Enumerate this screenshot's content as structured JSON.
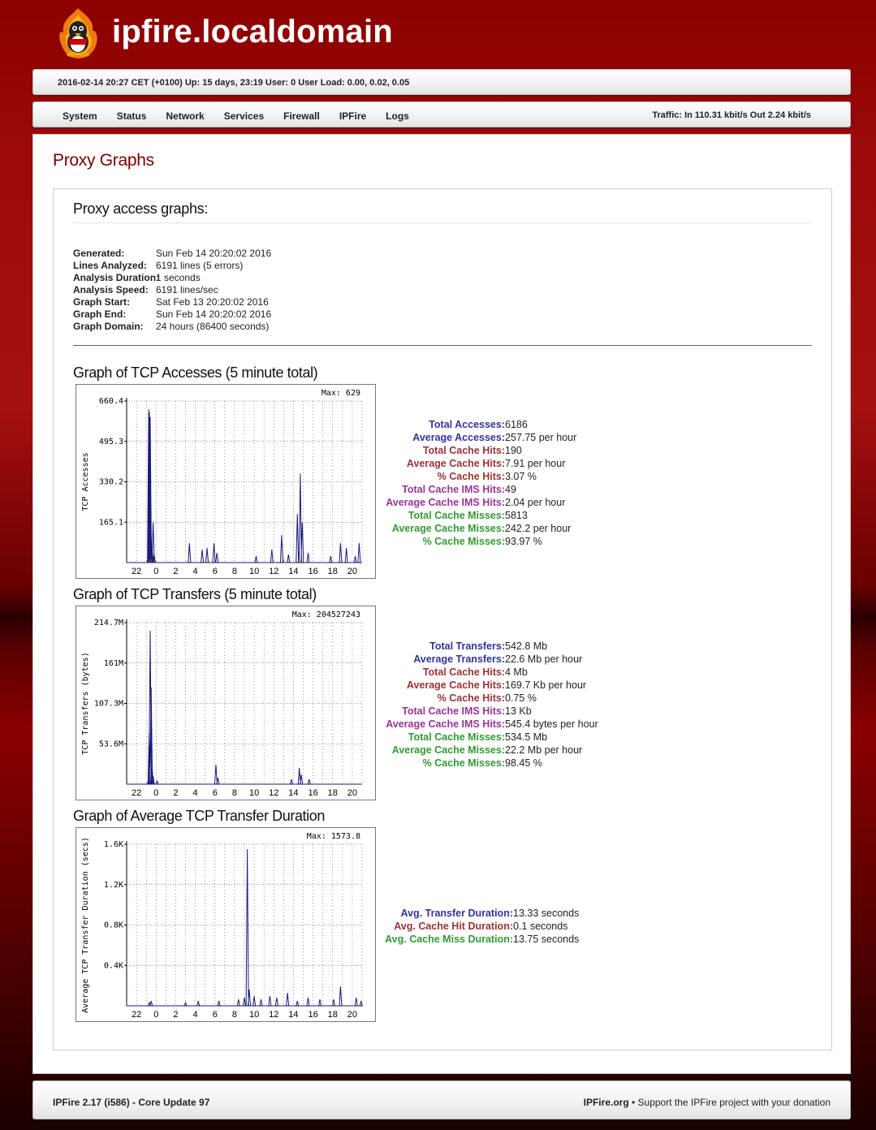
{
  "header": {
    "title": "ipfire.localdomain",
    "logo_icon": "ipfire-penguin-flame-logo"
  },
  "infobar": {
    "text": "2016-02-14 20:27 CET (+0100)   Up: 15 days, 23:19   User: 0 User   Load: 0.00, 0.02, 0.05"
  },
  "nav": {
    "items": [
      "System",
      "Status",
      "Network",
      "Services",
      "Firewall",
      "IPFire",
      "Logs"
    ],
    "traffic": "Traffic: In 110.31 kbit/s   Out 2.24 kbit/s"
  },
  "page": {
    "title": "Proxy Graphs",
    "box_title": "Proxy access graphs:"
  },
  "meta": [
    {
      "k": "Generated:",
      "v": "Sun Feb 14 20:20:02 2016"
    },
    {
      "k": "Lines Analyzed:",
      "v": "6191 lines (5 errors)"
    },
    {
      "k": "Analysis Duration:",
      "v": "1 seconds"
    },
    {
      "k": "Analysis Speed:",
      "v": "6191 lines/sec"
    },
    {
      "k": "Graph Start:",
      "v": "Sat Feb 13 20:20:02 2016"
    },
    {
      "k": "Graph End:",
      "v": "Sun Feb 14 20:20:02 2016"
    },
    {
      "k": "Graph Domain:",
      "v": "24 hours (86400 seconds)"
    }
  ],
  "colors": {
    "blue": "#33339a",
    "red": "#993333",
    "purple": "#993399",
    "green": "#339933",
    "plot_line": "#1a1a7a"
  },
  "graphs": [
    {
      "title": "Graph of TCP Accesses (5 minute total)",
      "max_label": "Max: 629",
      "ylabel": "TCP Accesses",
      "yticks": [
        "660.4",
        "495.3",
        "330.2",
        "165.1"
      ],
      "xticks": [
        "22",
        "0",
        "2",
        "4",
        "6",
        "8",
        "10",
        "12",
        "14",
        "16",
        "18",
        "20"
      ],
      "stats": [
        {
          "label": "Total Accesses:",
          "value": "6186",
          "color": "blue"
        },
        {
          "label": "Average Accesses:",
          "value": "257.75 per hour",
          "color": "blue"
        },
        {
          "label": "Total Cache Hits:",
          "value": "190",
          "color": "red"
        },
        {
          "label": "Average Cache Hits:",
          "value": "7.91 per hour",
          "color": "red"
        },
        {
          "label": "% Cache Hits:",
          "value": "3.07 %",
          "color": "red"
        },
        {
          "label": "Total Cache IMS Hits:",
          "value": "49",
          "color": "purple"
        },
        {
          "label": "Average Cache IMS Hits:",
          "value": "2.04 per hour",
          "color": "purple"
        },
        {
          "label": "Total Cache Misses:",
          "value": "5813",
          "color": "green"
        },
        {
          "label": "Average Cache Misses:",
          "value": "242.2 per hour",
          "color": "green"
        },
        {
          "label": "% Cache Misses:",
          "value": "93.97 %",
          "color": "green"
        }
      ]
    },
    {
      "title": "Graph of TCP Transfers (5 minute total)",
      "max_label": "Max: 204527243",
      "ylabel": "TCP Transfers (bytes)",
      "yticks": [
        "214.7M",
        "161M",
        "107.3M",
        "53.6M"
      ],
      "xticks": [
        "22",
        "0",
        "2",
        "4",
        "6",
        "8",
        "10",
        "12",
        "14",
        "16",
        "18",
        "20"
      ],
      "stats": [
        {
          "label": "Total Transfers:",
          "value": "542.8 Mb",
          "color": "blue"
        },
        {
          "label": "Average Transfers:",
          "value": "22.6 Mb per hour",
          "color": "blue"
        },
        {
          "label": "Total Cache Hits:",
          "value": "4 Mb",
          "color": "red"
        },
        {
          "label": "Average Cache Hits:",
          "value": "169.7 Kb per hour",
          "color": "red"
        },
        {
          "label": "% Cache Hits:",
          "value": "0.75 %",
          "color": "red"
        },
        {
          "label": "Total Cache IMS Hits:",
          "value": "13 Kb",
          "color": "purple"
        },
        {
          "label": "Average Cache IMS Hits:",
          "value": "545.4 bytes per hour",
          "color": "purple"
        },
        {
          "label": "Total Cache Misses:",
          "value": "534.5 Mb",
          "color": "green"
        },
        {
          "label": "Average Cache Misses:",
          "value": "22.2 Mb per hour",
          "color": "green"
        },
        {
          "label": "% Cache Misses:",
          "value": "98.45 %",
          "color": "green"
        }
      ]
    },
    {
      "title": "Graph of Average TCP Transfer Duration",
      "max_label": "Max: 1573.8",
      "ylabel": "Average TCP Transfer Duration (secs)",
      "yticks": [
        "1.6K",
        "1.2K",
        "0.8K",
        "0.4K"
      ],
      "xticks": [
        "22",
        "0",
        "2",
        "4",
        "6",
        "8",
        "10",
        "12",
        "14",
        "16",
        "18",
        "20"
      ],
      "stats": [
        {
          "label": "Avg. Transfer Duration:",
          "value": "13.33 seconds",
          "color": "blue"
        },
        {
          "label": "Avg. Cache Hit Duration:",
          "value": "0.1 seconds",
          "color": "red"
        },
        {
          "label": "Avg. Cache Miss Duration:",
          "value": "13.75 seconds",
          "color": "green"
        }
      ]
    }
  ],
  "footer": {
    "left": "IPFire 2.17 (i586) - Core Update 97",
    "right_link": "IPFire.org",
    "right_text": " • Support the IPFire project with your donation"
  }
}
